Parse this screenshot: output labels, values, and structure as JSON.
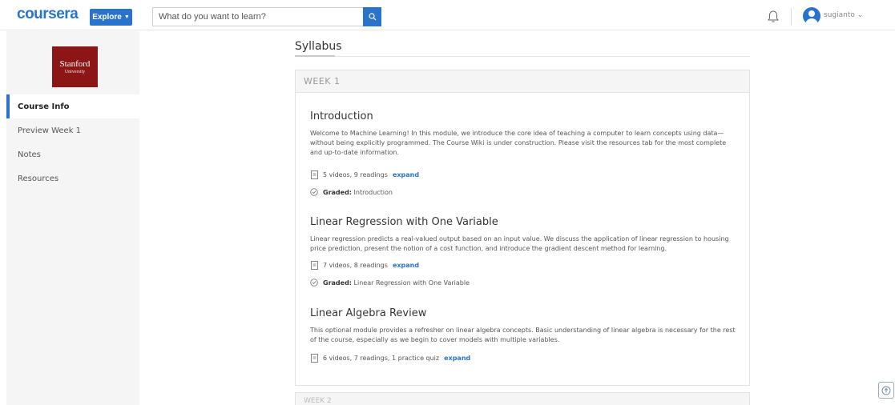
{
  "header": {
    "logo": "coursera",
    "explore_label": "Explore",
    "search_placeholder": "What do you want to learn?",
    "username": "sugianto"
  },
  "sidebar": {
    "university_name": "Stanford",
    "university_sub": "University",
    "items": [
      {
        "label": "Course Info",
        "active": true
      },
      {
        "label": "Preview Week 1",
        "active": false
      },
      {
        "label": "Notes",
        "active": false
      },
      {
        "label": "Resources",
        "active": false
      }
    ]
  },
  "main": {
    "title": "Syllabus",
    "week1": {
      "label": "WEEK 1",
      "modules": [
        {
          "title": "Introduction",
          "description": "Welcome to Machine Learning! In this module, we introduce the core idea of teaching a computer to learn concepts using data—without being explicitly programmed. The Course Wiki is under construction. Please visit the resources tab for the most complete and up-to-date information.",
          "content": "5 videos, 9 readings",
          "expand": "expand",
          "graded_label": "Graded:",
          "graded_value": "Introduction"
        },
        {
          "title": "Linear Regression with One Variable",
          "description": "Linear regression predicts a real-valued output based on an input value. We discuss the application of linear regression to housing price prediction, present the notion of a cost function, and introduce the gradient descent method for learning.",
          "content": "7 videos, 8 readings",
          "expand": "expand",
          "graded_label": "Graded:",
          "graded_value": "Linear Regression with One Variable"
        },
        {
          "title": "Linear Algebra Review",
          "description": "This optional module provides a refresher on linear algebra concepts. Basic understanding of linear algebra is necessary for the rest of the course, especially as we begin to cover models with multiple variables.",
          "content": "6 videos, 7 readings, 1 practice quiz",
          "expand": "expand"
        }
      ]
    },
    "week2": {
      "label": "WEEK 2"
    }
  },
  "colors": {
    "brand": "#2a73cc",
    "stanford": "#8c1515",
    "sidebar_bg": "#f5f5f5"
  },
  "icons": {
    "search": "search-icon",
    "notifications": "bell-icon",
    "content": "document-icon",
    "graded": "graded-badge-icon",
    "scroll_top": "scroll-top-icon"
  }
}
